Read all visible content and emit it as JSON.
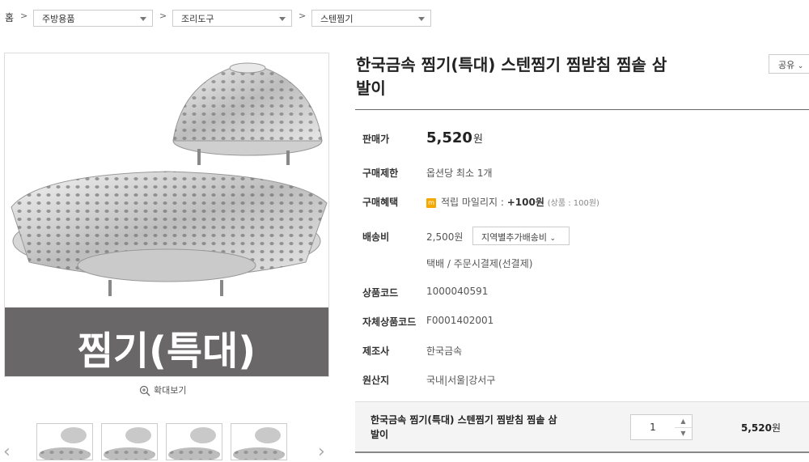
{
  "breadcrumb": {
    "home": "홈",
    "categories": [
      {
        "label": "주방용품"
      },
      {
        "label": "조리도구"
      },
      {
        "label": "스텐찜기"
      }
    ]
  },
  "image": {
    "banner_text": "찜기(특대)",
    "zoom_label": "확대보기",
    "thumbnail_count": 4
  },
  "product": {
    "title_line1": "한국금속 찜기(특대) 스텐찜기 찜받침 찜솥 삼",
    "title_line2": "발이",
    "share_label": "공유",
    "price_label": "판매가",
    "price_value": "5,520",
    "price_unit": "원",
    "limit_label": "구매제한",
    "limit_value": "옵션당 최소 1개",
    "benefit_label": "구매혜택",
    "benefit_badge": "m",
    "benefit_text": "적립 마일리지 : ",
    "benefit_points": "+100원",
    "benefit_detail": "(상품 : 100원)",
    "shipping_label": "배송비",
    "shipping_value": "2,500원",
    "shipping_button": "지역별추가배송비",
    "shipping_method": "택배  /  주문시결제(선결제)",
    "code_label": "상품코드",
    "code_value": "1000040591",
    "own_code_label": "자체상품코드",
    "own_code_value": "F0001402001",
    "maker_label": "제조사",
    "maker_value": "한국금속",
    "origin_label": "원산지",
    "origin_value": "국내|서울|강서구"
  },
  "order": {
    "name_line1": "한국금속 찜기(특대) 스텐찜기 찜받침 찜솥 삼",
    "name_line2": "발이",
    "quantity": "1",
    "price_value": "5,520",
    "price_unit": "원"
  },
  "colors": {
    "banner_bg": "#6a6768",
    "mileage_badge": "#f4a800",
    "divider": "#666666"
  }
}
